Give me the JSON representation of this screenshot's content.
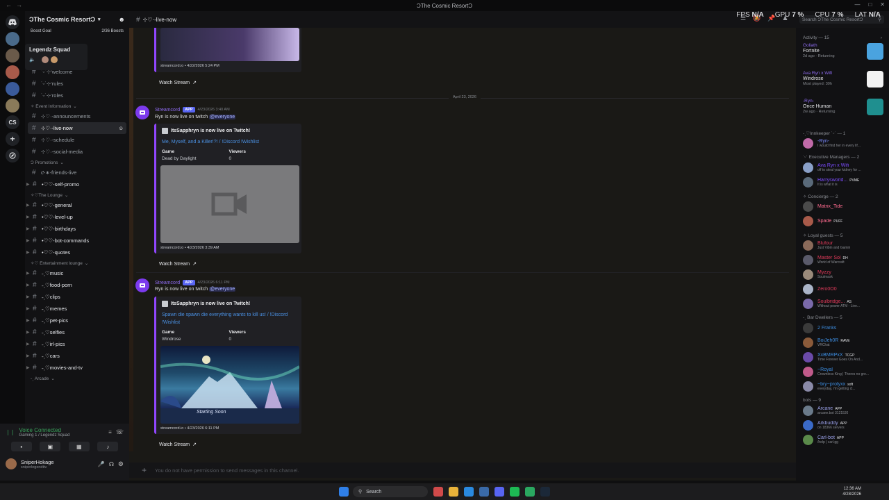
{
  "window": {
    "title": "ƆThe Cosmic ResortƆ",
    "controls": [
      "—",
      "□",
      "✕"
    ],
    "nav_back": "←",
    "nav_fwd": "→"
  },
  "server": {
    "name": "ƆThe Cosmic ResortƆ",
    "boost_label": "Boost Goal",
    "boost_count": "2/36 Boosts",
    "voice_popup": {
      "title": "Legendz Squad"
    }
  },
  "rail": {
    "cs_label": "CS"
  },
  "sidebar": {
    "categories": [
      {
        "label": "˚˖·₊˚fCheck-In",
        "channels": [
          {
            "label": "˙ᵕ˙⊹‘welcome",
            "state": "normal"
          },
          {
            "label": "˙ᵕ˙⊹‘rules",
            "state": "normal"
          },
          {
            "label": "˙ᵕ˙⊹‘roles",
            "state": "normal"
          }
        ]
      },
      {
        "label": "✧ Event Information",
        "channels": [
          {
            "label": "⊹♡·-announcements",
            "state": "normal"
          },
          {
            "label": "⊹♡·-live-now",
            "state": "active"
          },
          {
            "label": "⊹♡·-schedule",
            "state": "normal"
          },
          {
            "label": "⊹♡·-social-media",
            "state": "normal"
          }
        ]
      },
      {
        "label": "Ɔ Promotions",
        "channels": [
          {
            "label": "ƈ-∗-friends-live",
            "state": "normal"
          },
          {
            "label": "•♡♡-self-promo",
            "state": "unread"
          }
        ]
      },
      {
        "label": "✧♡The Lounge",
        "channels": [
          {
            "label": "•♡♡-general",
            "state": "unread"
          },
          {
            "label": "•♡♡-level-up",
            "state": "unread"
          },
          {
            "label": "•♡♡-birthdays",
            "state": "unread"
          },
          {
            "label": "•♡♡-bot-commands",
            "state": "unread"
          },
          {
            "label": "•♡♡-quotes",
            "state": "unread"
          }
        ]
      },
      {
        "label": "✧♡ Entertainment lounge",
        "channels": [
          {
            "label": "˗ˏ♡music",
            "state": "unread"
          },
          {
            "label": "˗ˏ♡food-porn",
            "state": "unread"
          },
          {
            "label": "˗ˏ♡clips",
            "state": "unread"
          },
          {
            "label": "˗ˏ♡memes",
            "state": "unread"
          },
          {
            "label": "˗ˏ♡pet-pics",
            "state": "unread"
          },
          {
            "label": "˗ˏ♡selfies",
            "state": "unread"
          },
          {
            "label": "˗ˏ♡irl-pics",
            "state": "unread"
          },
          {
            "label": "˗ˏ♡cars",
            "state": "unread"
          },
          {
            "label": "˗ˏ♡movies-and-tv",
            "state": "unread"
          }
        ]
      },
      {
        "label": "˗ˏ Arcade",
        "channels": []
      }
    ]
  },
  "voice": {
    "status": "Voice Connected",
    "channel": "Gaming 1 / Legendz Squad"
  },
  "user": {
    "name": "SniperHokage",
    "handle": "sniperlegendttv"
  },
  "topbar": {
    "channel": "⊹♡·-live-now",
    "search_placeholder": "Search ƆThe Cosmic ResortƆ",
    "overlay": {
      "fps_label": "FPS",
      "fps": "N/A",
      "gpu_label": "GPU",
      "gpu": "7 %",
      "cpu_label": "CPU",
      "cpu": "7 %",
      "lat_label": "LAT",
      "lat": "N/A"
    }
  },
  "chat": {
    "date_divider": "April 23, 2026",
    "first_footer": "streamcord.io • 4/22/2026 5:24 PM",
    "watch_label": "Watch Stream",
    "messages": [
      {
        "author": "Streamcord",
        "badge": "APP",
        "time": "4/23/2026 3:40 AM",
        "body": "Ryn is now live on twitch",
        "mention": "@everyone",
        "embed_author": "ItsSapphryn is now live on Twitch!",
        "embed_title": "Me, Myself, and a Killer!?! / !Discord !Wishlist",
        "game_label": "Game",
        "game": "Dead by Daylight",
        "viewers_label": "Viewers",
        "viewers": "0",
        "footer": "streamcord.io • 4/23/2026 3:39 AM"
      },
      {
        "author": "Streamcord",
        "badge": "APP",
        "time": "4/23/2026 6:11 PM",
        "body": "Ryn is now live on twitch",
        "mention": "@everyone",
        "embed_author": "ItsSapphryn is now live on Twitch!",
        "embed_title": "Spawn die spawn die everything wants to kill us! / !Discord !Wishlist",
        "game_label": "Game",
        "game": "Windrose",
        "viewers_label": "Viewers",
        "viewers": "0",
        "footer": "streamcord.io • 4/23/2026 6:11 PM",
        "image_caption": "Starting Soon"
      }
    ],
    "composer_placeholder": "You do not have permission to send messages in this channel."
  },
  "members": {
    "activity_header": "Activity — 15",
    "activities": [
      {
        "who": "Goliath",
        "game": "Fortnite",
        "meta": "2d ago · Returning",
        "color": "#8e6cf0",
        "thumb": "#4aa3df"
      },
      {
        "who": "Ava Ryn x Wifi",
        "game": "Windrose",
        "meta": "Most played: 30h",
        "color": "#8e6cf0",
        "thumb": "#f2f2f2"
      },
      {
        "who": "-Ryn-",
        "game": "Once Human",
        "meta": "2w ago · Returning",
        "color": "#8e6cf0",
        "thumb": "#1f8f8f"
      }
    ],
    "groups": [
      {
        "label": "˗ˏ♡Innkeeper ˙ᵕ˙ — 1",
        "items": [
          {
            "name": "-Ryn-",
            "status": "I would find her in every lif...",
            "color": "#7c8cff",
            "av": "#c06aa8",
            "tag": ""
          }
        ]
      },
      {
        "label": "˙ᵕ˙ Executive Managers — 2",
        "items": [
          {
            "name": "Ava Ryn x Wifi",
            "status": "off to steal your kidney for ...",
            "color": "#7c4dff",
            "av": "#8aa0c8",
            "tag": ""
          },
          {
            "name": "Harrysworld...",
            "status": "It is what it is",
            "color": "#7c4dff",
            "av": "#5a6a7a",
            "tag": "PVME"
          }
        ]
      },
      {
        "label": "✧ Concierge — 2",
        "items": [
          {
            "name": "Matrix_Tide",
            "status": "",
            "color": "#ff6b8f",
            "av": "#4a4a4a",
            "tag": ""
          },
          {
            "name": "Spade",
            "status": "",
            "color": "#ff6b8f",
            "av": "#a85a4a",
            "tag": "PUFF"
          }
        ]
      },
      {
        "label": "✧ Loyal guests — 5",
        "items": [
          {
            "name": "Blufour",
            "status": "Just Vibin and Gamin",
            "color": "#e03a5a",
            "av": "#8a6a5a",
            "tag": ""
          },
          {
            "name": "Master Sol",
            "status": "World of Warcraft",
            "color": "#e03a5a",
            "av": "#5a5a6a",
            "tag": "DH"
          },
          {
            "name": "Myzzy",
            "status": "Soulmask",
            "color": "#e03a5a",
            "av": "#9a8a7a",
            "tag": ""
          },
          {
            "name": "Zero0O0",
            "status": "",
            "color": "#e03a5a",
            "av": "#aab4c8",
            "tag": ""
          },
          {
            "name": "Soulbridge...",
            "status": "Without power ATM - Live...",
            "color": "#e03a5a",
            "av": "#7a6aaa",
            "tag": "AS"
          }
        ]
      },
      {
        "label": "˗ˏ Bar Dwellers — 5",
        "items": [
          {
            "name": "2 Franks",
            "status": "",
            "color": "#3d8de0",
            "av": "#3a3a3a",
            "tag": ""
          },
          {
            "name": "BoiJeh0R",
            "status": "VRChat",
            "color": "#3d8de0",
            "av": "#8a5a3a",
            "tag": "RAVE"
          },
          {
            "name": "XxBMRPxX",
            "status": "Time Forever Goes On And...",
            "color": "#3d8de0",
            "av": "#6a4aa8",
            "tag": "TCGP"
          },
          {
            "name": "~Royal",
            "status": "Crownless King | Theres no gre...",
            "color": "#3d8de0",
            "av": "#c05a8a",
            "tag": ""
          },
          {
            "name": "~bry~prolyxx",
            "status": "everyday, i'm getting cl...",
            "color": "#3d8de0",
            "av": "#8a8aa8",
            "tag": "soft"
          }
        ]
      },
      {
        "label": "bots — 9",
        "items": [
          {
            "name": "Arcane",
            "status": "arcane.bot 3121536",
            "color": "#9aa0e8",
            "av": "#6a7a8a",
            "tag": "APP"
          },
          {
            "name": "Arkbuddy",
            "status": "on 18366 servers",
            "color": "#9aa0e8",
            "av": "#3a6ac8",
            "tag": "APP"
          },
          {
            "name": "Carl-bot",
            "status": "/help | carl.gg",
            "color": "#9aa0e8",
            "av": "#5a8a4a",
            "tag": "APP"
          }
        ]
      }
    ]
  },
  "taskbar": {
    "search_label": "Search",
    "time": "12:36 AM",
    "date": "4/28/2026"
  }
}
